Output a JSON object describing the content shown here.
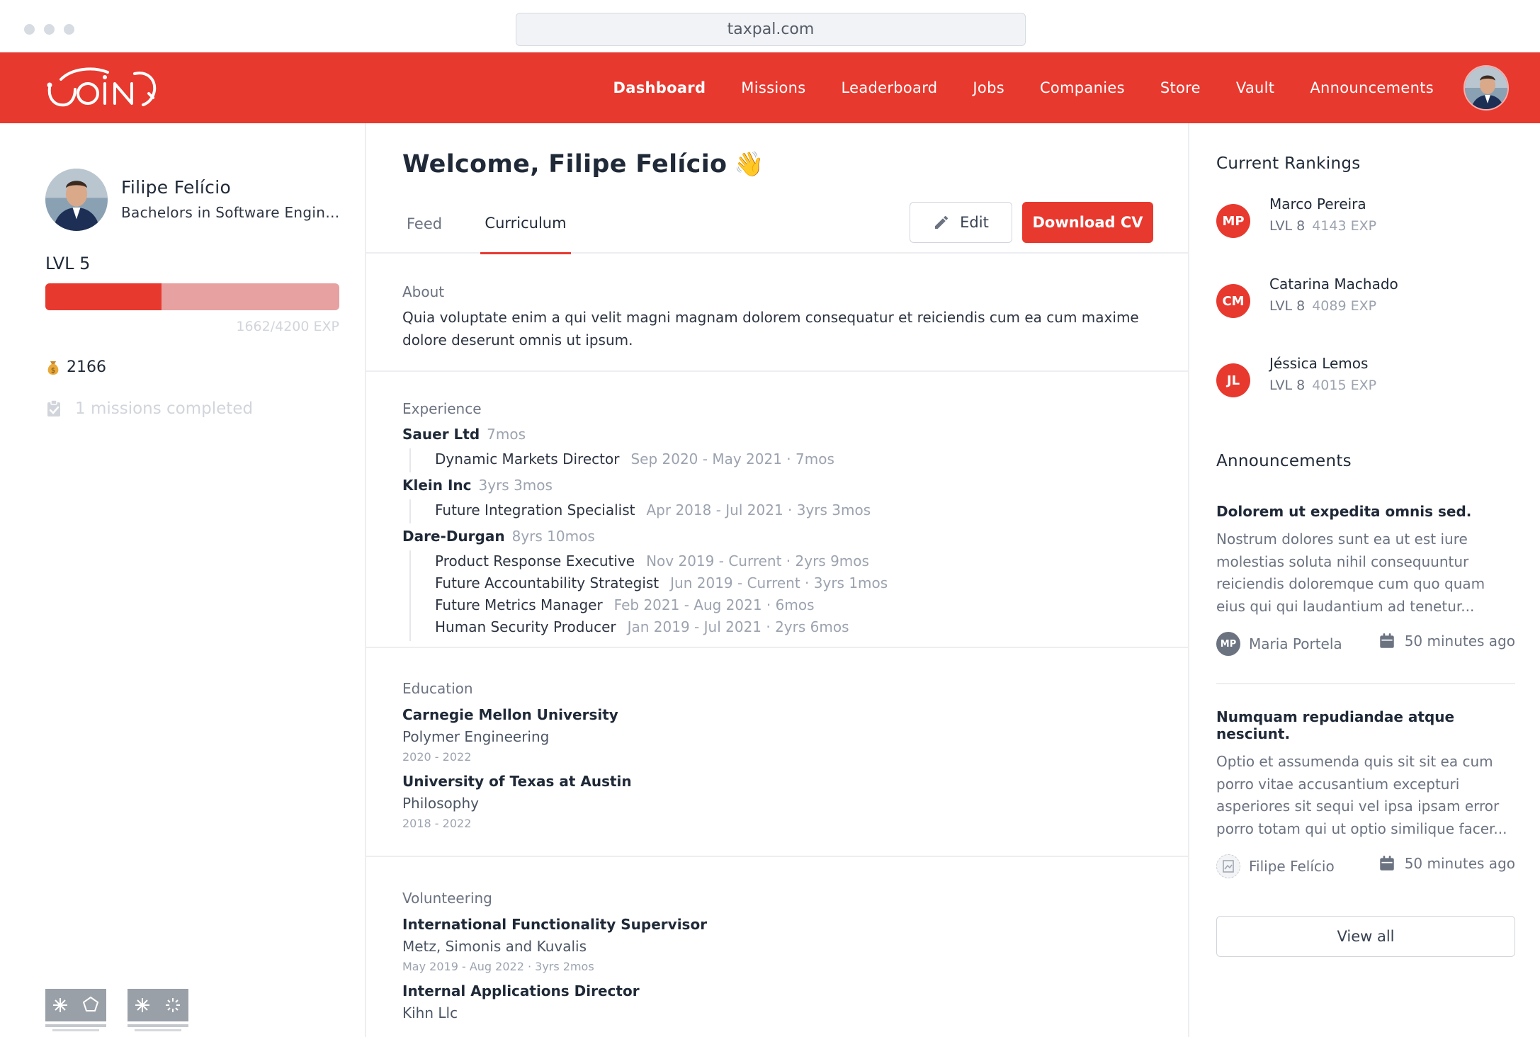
{
  "browser": {
    "url": "taxpal.com"
  },
  "nav": {
    "logo_text": "JOIN",
    "links": [
      "Dashboard",
      "Missions",
      "Leaderboard",
      "Jobs",
      "Companies",
      "Store",
      "Vault",
      "Announcements"
    ],
    "active": "Dashboard"
  },
  "profile": {
    "name": "Filipe Felício",
    "subtitle": "Bachelors in Software Engineering",
    "level": "LVL 5",
    "xp_current": 1662,
    "xp_total": 4200,
    "xp_text": "1662/4200 EXP",
    "coins": "2166",
    "missions": "1 missions completed"
  },
  "main": {
    "welcome": "Welcome, Filipe Felício",
    "wave_emoji": "👋",
    "tabs": {
      "feed": "Feed",
      "curriculum": "Curriculum"
    },
    "edit_label": "Edit",
    "download_label": "Download CV",
    "about": {
      "title": "About",
      "text": "Quia voluptate enim a qui velit magni magnam dolorem consequatur et reiciendis cum ea cum maxime dolore deserunt omnis ut ipsum."
    },
    "experience": {
      "title": "Experience",
      "companies": [
        {
          "name": "Sauer Ltd",
          "duration": "7mos",
          "roles": [
            {
              "title": "Dynamic Markets Director",
              "dates": "Sep 2020 - May 2021 · 7mos"
            }
          ]
        },
        {
          "name": "Klein Inc",
          "duration": "3yrs 3mos",
          "roles": [
            {
              "title": "Future Integration Specialist",
              "dates": "Apr 2018 - Jul 2021 · 3yrs 3mos"
            }
          ]
        },
        {
          "name": "Dare-Durgan",
          "duration": "8yrs 10mos",
          "roles": [
            {
              "title": "Product Response Executive",
              "dates": "Nov 2019 - Current · 2yrs 9mos"
            },
            {
              "title": "Future Accountability Strategist",
              "dates": "Jun 2019 - Current · 3yrs 1mos"
            },
            {
              "title": "Future Metrics Manager",
              "dates": "Feb 2021 - Aug 2021 · 6mos"
            },
            {
              "title": "Human Security Producer",
              "dates": "Jan 2019 - Jul 2021 · 2yrs 6mos"
            }
          ]
        }
      ]
    },
    "education": {
      "title": "Education",
      "items": [
        {
          "school": "Carnegie Mellon University",
          "field": "Polymer Engineering",
          "dates": "2020 - 2022"
        },
        {
          "school": "University of Texas at Austin",
          "field": "Philosophy",
          "dates": "2018 - 2022"
        }
      ]
    },
    "volunteering": {
      "title": "Volunteering",
      "items": [
        {
          "role": "International Functionality Supervisor",
          "org": "Metz, Simonis and Kuvalis",
          "dates": "May 2019 - Aug 2022 · 3yrs 2mos"
        },
        {
          "role": "Internal Applications Director",
          "org": "Kihn Llc"
        }
      ]
    }
  },
  "rankings": {
    "title": "Current Rankings",
    "items": [
      {
        "initials": "MP",
        "name": "Marco Pereira",
        "level": "LVL 8",
        "exp": "4143 EXP"
      },
      {
        "initials": "CM",
        "name": "Catarina Machado",
        "level": "LVL 8",
        "exp": "4089 EXP"
      },
      {
        "initials": "JL",
        "name": "Jéssica Lemos",
        "level": "LVL 8",
        "exp": "4015 EXP"
      }
    ]
  },
  "announcements": {
    "title": "Announcements",
    "items": [
      {
        "title": "Dolorem ut expedita omnis sed.",
        "body": "Nostrum dolores sunt ea ut est iure molestias soluta nihil consequuntur reiciendis doloremque cum quo quam eius qui qui laudantium ad tenetur...",
        "author_initials": "MP",
        "author": "Maria Portela",
        "time": "50 minutes ago"
      },
      {
        "title": "Numquam repudiandae atque nesciunt.",
        "body": "Optio et assumenda quis sit sit ea cum porro vitae accusantium excepturi asperiores sit sequi vel ipsa ipsam error porro totam qui ut optio similique facer...",
        "author": "Filipe Felício",
        "time": "50 minutes ago"
      }
    ],
    "view_all": "View all"
  },
  "colors": {
    "brand": "#e8392f",
    "brand_light": "#e6a1a0"
  },
  "footer": {
    "logos": [
      "Universidade do Minho – Escola de Engenharia",
      "Universidade do Minho – Escola de Ciências"
    ]
  }
}
